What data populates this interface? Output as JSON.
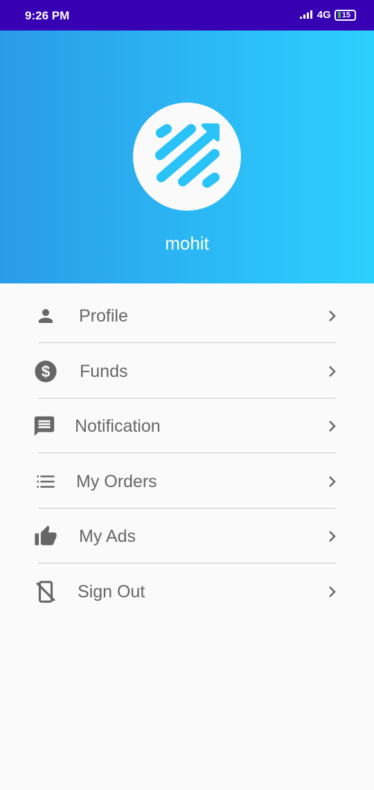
{
  "status_bar": {
    "time": "9:26 PM",
    "network": "4G",
    "battery": "15"
  },
  "header": {
    "username": "mohit"
  },
  "menu": {
    "items": [
      {
        "label": "Profile",
        "icon": "person-icon"
      },
      {
        "label": "Funds",
        "icon": "dollar-icon"
      },
      {
        "label": "Notification",
        "icon": "message-icon"
      },
      {
        "label": "My Orders",
        "icon": "list-icon"
      },
      {
        "label": "My Ads",
        "icon": "thumb-up-icon"
      },
      {
        "label": "Sign Out",
        "icon": "phone-off-icon"
      }
    ]
  },
  "colors": {
    "status_bar": "#3700b3",
    "gradient_start": "#2a9be8",
    "gradient_end": "#2cd0ff",
    "icon": "#666666"
  }
}
